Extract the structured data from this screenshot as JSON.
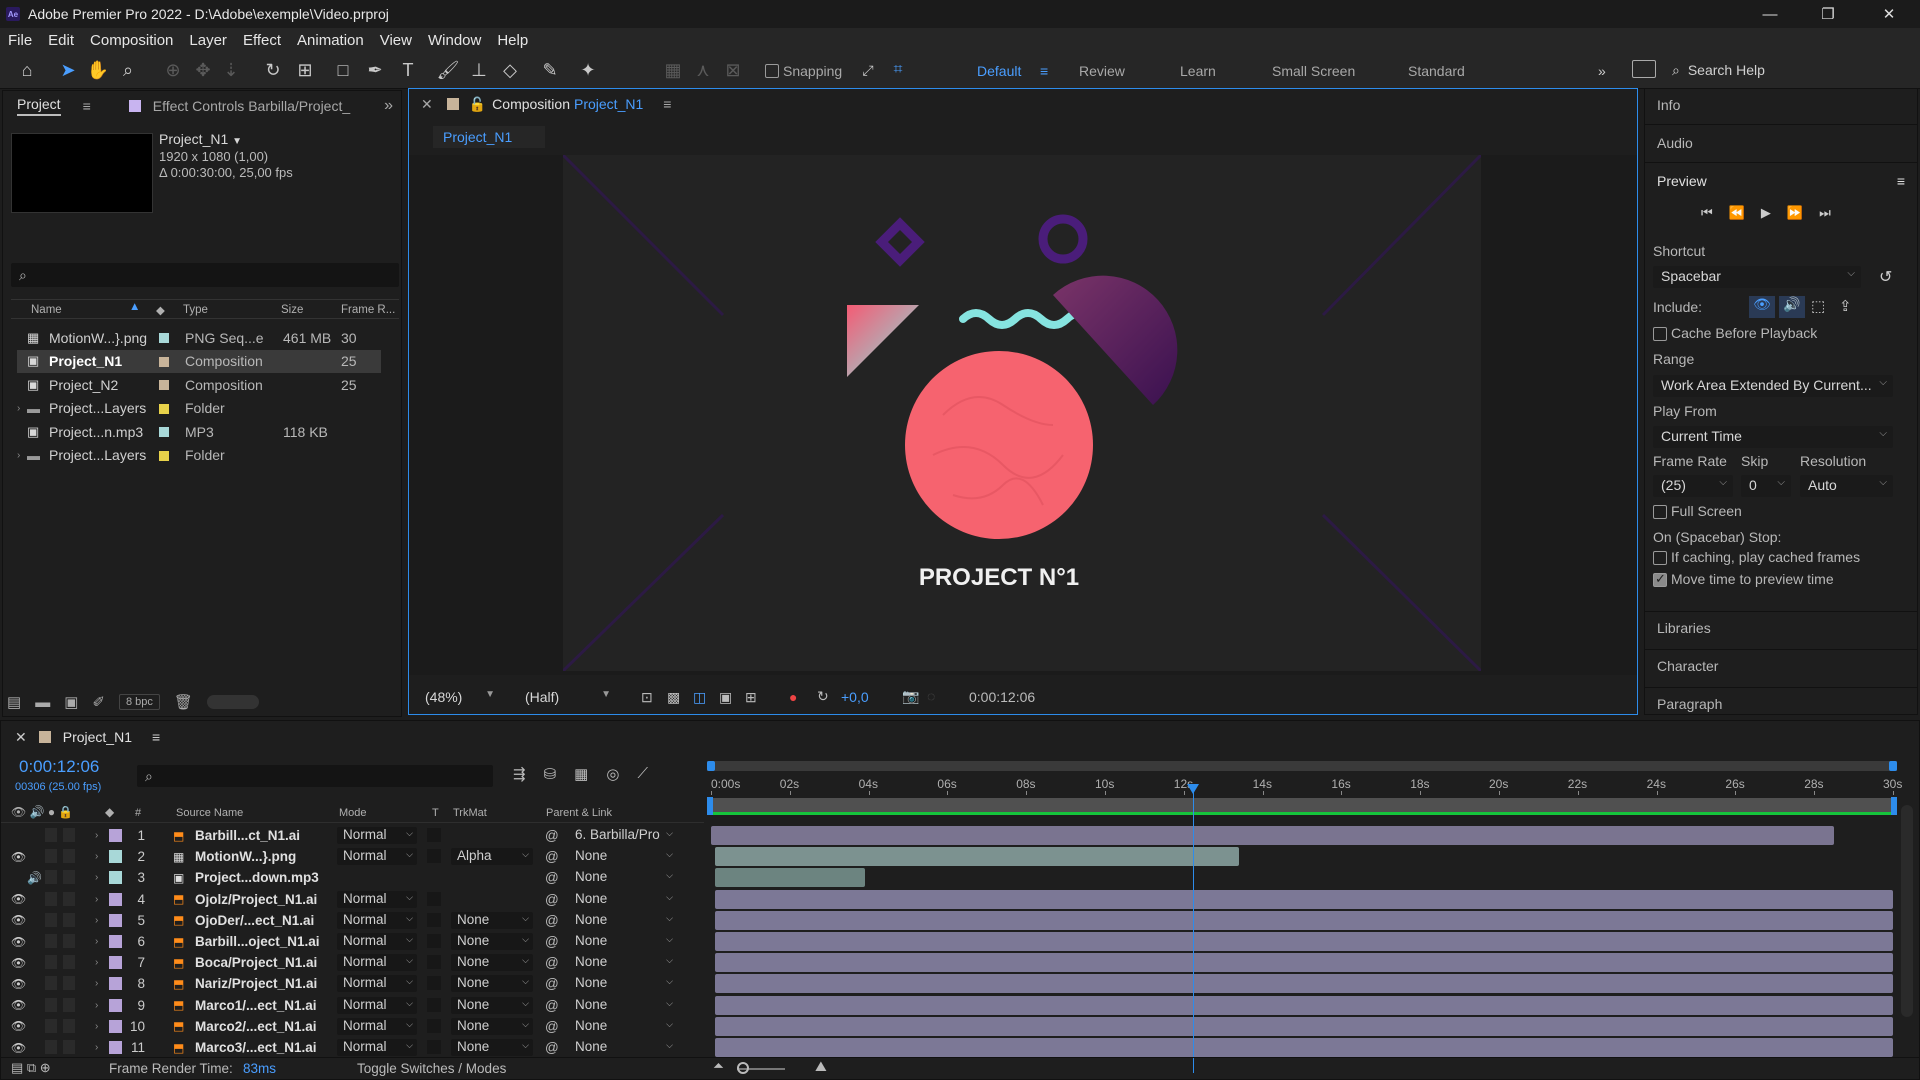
{
  "app": {
    "logo": "Ae",
    "title": "Adobe Premier Pro 2022 - D:\\Adobe\\exemple\\Video.prproj",
    "window_controls": [
      "minimize",
      "restore",
      "close"
    ]
  },
  "menu": [
    "File",
    "Edit",
    "Composition",
    "Layer",
    "Effect",
    "Animation",
    "View",
    "Window",
    "Help"
  ],
  "toolbar": {
    "snapping_label": "Snapping",
    "workspaces": [
      "Default",
      "Review",
      "Learn",
      "Small Screen",
      "Standard"
    ],
    "active_workspace": "Default",
    "search_placeholder": "Search Help"
  },
  "project": {
    "tab_label": "Project",
    "effect_controls_label": "Effect Controls Barbilla/Project_",
    "comp_name": "Project_N1",
    "comp_res": "1920 x 1080 (1,00)",
    "comp_dur": "Δ 0:00:30:00, 25,00 fps",
    "search_value": "",
    "columns": [
      "Name",
      "Type",
      "Size",
      "Frame R..."
    ],
    "items": [
      {
        "name": "MotionW...}.png",
        "type": "PNG Seq...e",
        "size": "461 MB",
        "fr": "30",
        "color": "#a8d8d8",
        "kind": "png",
        "selected": false,
        "folder": false
      },
      {
        "name": "Project_N1",
        "type": "Composition",
        "size": "",
        "fr": "25",
        "color": "#c8b49a",
        "kind": "comp",
        "selected": true,
        "folder": false
      },
      {
        "name": "Project_N2",
        "type": "Composition",
        "size": "",
        "fr": "25",
        "color": "#c8b49a",
        "kind": "comp",
        "selected": false,
        "folder": false
      },
      {
        "name": "Project...Layers",
        "type": "Folder",
        "size": "",
        "fr": "",
        "color": "#e8d24a",
        "kind": "folder",
        "selected": false,
        "folder": true
      },
      {
        "name": "Project...n.mp3",
        "type": "MP3",
        "size": "118 KB",
        "fr": "",
        "color": "#a8d8d8",
        "kind": "audio",
        "selected": false,
        "folder": false
      },
      {
        "name": "Project...Layers",
        "type": "Folder",
        "size": "",
        "fr": "",
        "color": "#e8d24a",
        "kind": "folder",
        "selected": false,
        "folder": true
      }
    ],
    "bpc": "8 bpc"
  },
  "composition": {
    "tab_prefix": "Composition",
    "tab_name": "Project_N1",
    "sub_tab": "Project_N1",
    "canvas_title": "PROJECT N°1",
    "zoom": "(48%)",
    "resolution": "(Half)",
    "exposure": "+0,0",
    "timecode": "0:00:12:06"
  },
  "right": {
    "info": "Info",
    "audio": "Audio",
    "preview": "Preview",
    "shortcut_label": "Shortcut",
    "shortcut_value": "Spacebar",
    "include_label": "Include:",
    "cache_label": "Cache Before Playback",
    "range_label": "Range",
    "range_value": "Work Area Extended By Current...",
    "play_from_label": "Play From",
    "play_from_value": "Current Time",
    "frame_rate_label": "Frame Rate",
    "skip_label": "Skip",
    "resolution_label": "Resolution",
    "frame_rate_value": "(25)",
    "skip_value": "0",
    "resolution_value": "Auto",
    "full_screen_label": "Full Screen",
    "on_stop_label": "On (Spacebar) Stop:",
    "if_caching_label": "If caching, play cached frames",
    "move_time_label": "Move time to preview time",
    "cache_before_playback": false,
    "full_screen": false,
    "if_caching": false,
    "move_time": true,
    "libraries": "Libraries",
    "character": "Character",
    "paragraph": "Paragraph"
  },
  "timeline": {
    "comp_tab": "Project_N1",
    "timecode": "0:00:12:06",
    "frames_info": "00306 (25.00 fps)",
    "search_value": "",
    "col_source": "Source Name",
    "col_mode": "Mode",
    "col_t": "T",
    "col_trkmat": "TrkMat",
    "col_parent": "Parent & Link",
    "col_num": "#",
    "ruler": [
      "0:00s",
      "02s",
      "04s",
      "06s",
      "08s",
      "10s",
      "12s",
      "14s",
      "16s",
      "18s",
      "20s",
      "22s",
      "24s",
      "26s",
      "28s",
      "30s"
    ],
    "duration_seconds": 30,
    "current_time_seconds": 12.24,
    "layers": [
      {
        "num": "1",
        "name": "Barbill...ct_N1.ai",
        "mode": "Normal",
        "trkmat": "",
        "parent": "6. Barbilla/Pro",
        "color": "#b7a3d8",
        "eye": false,
        "audio": false,
        "icon": "ai",
        "start": 0,
        "end": 28.5,
        "bar": "#7a7490"
      },
      {
        "num": "2",
        "name": "MotionW...}.png",
        "mode": "Normal",
        "trkmat": "Alpha",
        "parent": "None",
        "color": "#a8d8d8",
        "eye": true,
        "audio": false,
        "icon": "png",
        "start": 0.1,
        "end": 13.4,
        "bar": "#7c9290"
      },
      {
        "num": "3",
        "name": "Project...down.mp3",
        "mode": "",
        "trkmat": "",
        "parent": "None",
        "color": "#a8d8d8",
        "eye": false,
        "audio": true,
        "icon": "audio",
        "start": 0.1,
        "end": 3.9,
        "bar": "#6c8480"
      },
      {
        "num": "4",
        "name": "Ojolz/Project_N1.ai",
        "mode": "Normal",
        "trkmat": "",
        "parent": "None",
        "color": "#b7a3d8",
        "eye": true,
        "audio": false,
        "icon": "ai",
        "start": 0.1,
        "end": 30,
        "bar": "#7c7896"
      },
      {
        "num": "5",
        "name": "OjoDer/...ect_N1.ai",
        "mode": "Normal",
        "trkmat": "None",
        "parent": "None",
        "color": "#b7a3d8",
        "eye": true,
        "audio": false,
        "icon": "ai",
        "start": 0.1,
        "end": 30,
        "bar": "#7c7896"
      },
      {
        "num": "6",
        "name": "Barbill...oject_N1.ai",
        "mode": "Normal",
        "trkmat": "None",
        "parent": "None",
        "color": "#b7a3d8",
        "eye": true,
        "audio": false,
        "icon": "ai",
        "start": 0.1,
        "end": 30,
        "bar": "#7c7896"
      },
      {
        "num": "7",
        "name": "Boca/Project_N1.ai",
        "mode": "Normal",
        "trkmat": "None",
        "parent": "None",
        "color": "#b7a3d8",
        "eye": true,
        "audio": false,
        "icon": "ai",
        "start": 0.1,
        "end": 30,
        "bar": "#7c7896"
      },
      {
        "num": "8",
        "name": "Nariz/Project_N1.ai",
        "mode": "Normal",
        "trkmat": "None",
        "parent": "None",
        "color": "#b7a3d8",
        "eye": true,
        "audio": false,
        "icon": "ai",
        "start": 0.1,
        "end": 30,
        "bar": "#7c7896"
      },
      {
        "num": "9",
        "name": "Marco1/...ect_N1.ai",
        "mode": "Normal",
        "trkmat": "None",
        "parent": "None",
        "color": "#b7a3d8",
        "eye": true,
        "audio": false,
        "icon": "ai",
        "start": 0.1,
        "end": 30,
        "bar": "#7c7896"
      },
      {
        "num": "10",
        "name": "Marco2/...ect_N1.ai",
        "mode": "Normal",
        "trkmat": "None",
        "parent": "None",
        "color": "#b7a3d8",
        "eye": true,
        "audio": false,
        "icon": "ai",
        "start": 0.1,
        "end": 30,
        "bar": "#7c7896"
      },
      {
        "num": "11",
        "name": "Marco3/...ect_N1.ai",
        "mode": "Normal",
        "trkmat": "None",
        "parent": "None",
        "color": "#b7a3d8",
        "eye": true,
        "audio": false,
        "icon": "ai",
        "start": 0.1,
        "end": 30,
        "bar": "#7c7896"
      }
    ],
    "render_label": "Frame Render Time:",
    "render_value": "83ms",
    "toggle_label": "Toggle Switches / Modes"
  },
  "colors": {
    "accent": "#2d8ceb",
    "blue_text": "#4a9eff",
    "playhead": "#2d8ceb",
    "workarea": "#16c43c"
  }
}
